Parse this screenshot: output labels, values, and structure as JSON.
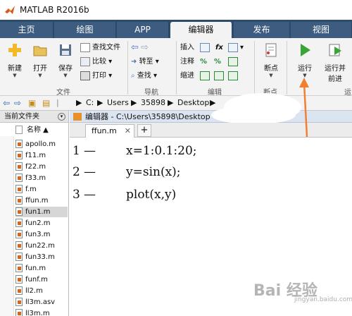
{
  "titlebar": {
    "title": "MATLAB R2016b"
  },
  "tabs": [
    "主页",
    "绘图",
    "APP",
    "编辑器",
    "发布",
    "视图"
  ],
  "ribbon": {
    "new": "新建",
    "open": "打开",
    "save": "保存",
    "find_files": "查找文件",
    "compare": "比较",
    "print": "打印",
    "goto": "转至",
    "find": "查找",
    "insert": "插入",
    "comment": "注释",
    "indent": "缩进",
    "fx": "fx",
    "breakpoints": "断点",
    "run": "运行",
    "run_advance_1": "运行并",
    "run_advance_2": "前进",
    "groups": {
      "file": "文件",
      "navigate": "导航",
      "edit": "编辑",
      "breakpoints": "断点",
      "run": "运"
    }
  },
  "address": {
    "path": [
      "C:",
      "Users",
      "35898",
      "Desktop"
    ]
  },
  "leftpanel": {
    "title": "当前文件夹",
    "column": "名称 ▲",
    "files": [
      "apollo.m",
      "f11.m",
      "f22.m",
      "f33.m",
      "f.m",
      "ffun.m",
      "fun1.m",
      "fun2.m",
      "fun3.m",
      "fun22.m",
      "fun33.m",
      "fun.m",
      "funf.m",
      "ll2.m",
      "ll3m.asv",
      "ll3m.m"
    ]
  },
  "editor": {
    "title": "编辑器 - C:\\Users\\35898\\Desktop",
    "tab": "ffun.m",
    "lines": [
      {
        "num": "1",
        "code": "x=1:0.1:20;"
      },
      {
        "num": "2",
        "code": "y=sin(x);"
      },
      {
        "num": "3",
        "code": "plot(x,y)"
      }
    ]
  },
  "watermark": {
    "text": "Bai 经验",
    "url": "jingyan.baidu.com"
  },
  "colors": {
    "tabbar": "#2d4b6b",
    "accent_orange": "#f08030",
    "run_green": "#3aa535"
  }
}
